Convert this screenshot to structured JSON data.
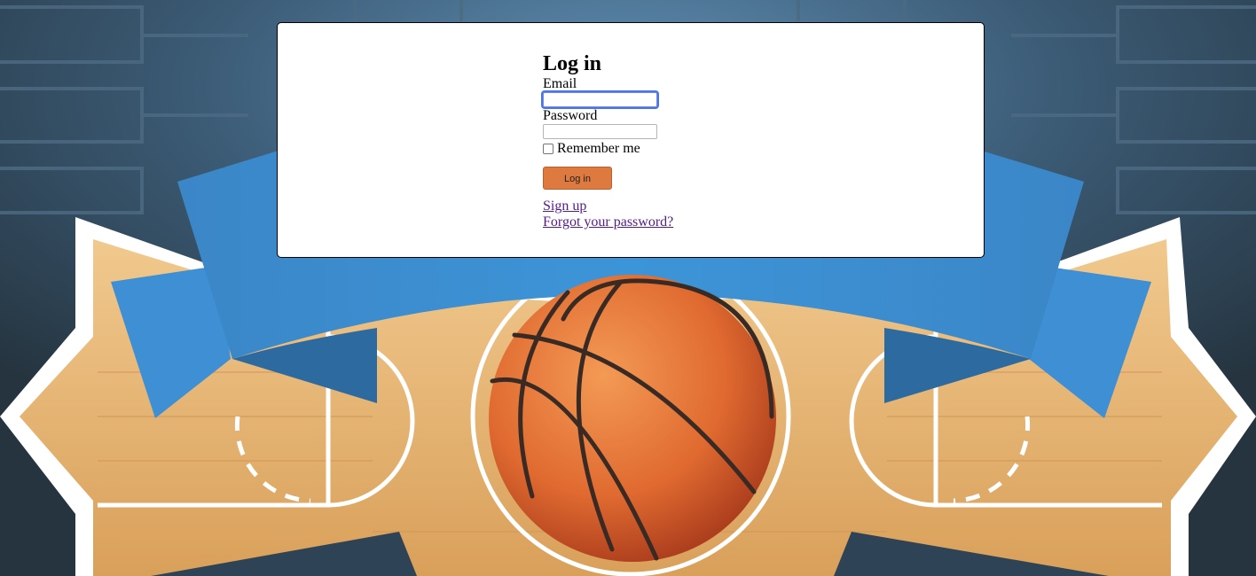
{
  "login": {
    "title": "Log in",
    "email_label": "Email",
    "email_value": "",
    "password_label": "Password",
    "password_value": "",
    "remember_label": "Remember me",
    "remember_checked": false,
    "submit_label": "Log in",
    "signup_link": "Sign up",
    "forgot_link": "Forgot your password?"
  },
  "colors": {
    "button": "#de7a40",
    "link": "#551a8b",
    "banner": "#3a8fd0",
    "court": "#e0a866",
    "ball": "#e06a30",
    "backdrop": "#2c3e4e"
  },
  "background": {
    "icons": [
      "tournament-bracket",
      "basketball-court",
      "basketball",
      "ribbon-banner"
    ]
  }
}
